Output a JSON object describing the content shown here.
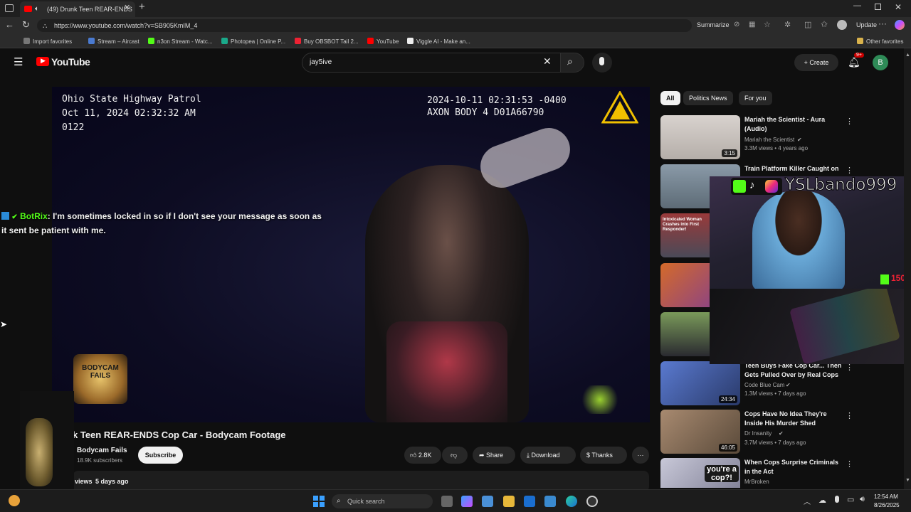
{
  "browser": {
    "tab_title": "(49) Drunk Teen REAR-ENDS",
    "url": "https://www.youtube.com/watch?v=SB905KmIM_4",
    "summarize_label": "Summarize",
    "update_label": "Update",
    "bookmarks": [
      "Import favorites",
      "Stream – Aircast",
      "n3on Stream - Watc...",
      "Photopea | Online P...",
      "Buy OBSBOT Tail 2...",
      "YouTube",
      "Viggle AI - Make an..."
    ],
    "other_favorites": "Other favorites"
  },
  "youtube": {
    "logo": "YouTube",
    "search_value": "jay5ive",
    "create_label": "Create",
    "notif_badge": "9+",
    "avatar_letter": "B"
  },
  "video": {
    "overlay_agency": "Ohio State Highway Patrol",
    "overlay_date": "Oct 11, 2024 02:32:32 AM",
    "overlay_unit": "0122",
    "overlay_timestamp": "2024-10-11 02:31:53 -0400",
    "overlay_device": "AXON BODY 4 D01A66790",
    "watermark_line1": "BODYCAM",
    "watermark_line2": "FAILS",
    "title": "k Teen REAR-ENDS Cop Car - Bodycam Footage",
    "channel": "Bodycam Fails",
    "subscribers": "18.9K subscribers",
    "subscribe_label": "Subscribe",
    "likes": "2.8K",
    "share_label": "Share",
    "download_label": "Download",
    "thanks_label": "Thanks",
    "views": "views",
    "posted": "5 days ago"
  },
  "chips": [
    "All",
    "Politics News",
    "For you"
  ],
  "recommendations": [
    {
      "title": "Mariah the Scientist - Aura (Audio)",
      "channel": "Mariah the Scientist",
      "stats": "3.3M views • 4 years ago",
      "duration": "3:15",
      "thumb": "#c9c3bf"
    },
    {
      "title": "Train Platform Killer Caught on",
      "channel": "",
      "stats": "",
      "duration": "",
      "thumb": "#7b8b98"
    },
    {
      "title": "",
      "channel": "",
      "stats": "",
      "duration": "",
      "thumb": "#8a3b3b",
      "thumb_text": "Intoxicated Woman Crashes into First Responder!"
    },
    {
      "title": "",
      "channel": "",
      "stats": "",
      "duration": "",
      "thumb": "#b04a2a"
    },
    {
      "title": "",
      "channel": "",
      "stats": "",
      "duration": "",
      "thumb": "#5b7d4c"
    },
    {
      "title": "Teen Buys Fake Cop Car... Then Gets Pulled Over by Real Cops",
      "channel": "Code Blue Cam",
      "stats": "1.3M views • 7 days ago",
      "duration": "24:34",
      "thumb": "#3c5ca8"
    },
    {
      "title": "Cops Have No Idea They're Inside His Murder Shed",
      "channel": "Dr Insanity",
      "stats": "3.7M views • 7 days ago",
      "duration": "46:05",
      "thumb": "#8b6e5a"
    },
    {
      "title": "When Cops Surprise Criminals in the Act",
      "channel": "MrBroken",
      "stats": "",
      "duration": "",
      "thumb": "#9aa0b0",
      "thumb_text": "you're a cop?!"
    }
  ],
  "stream": {
    "chat_user": "BotRix",
    "chat_message": ": I'm sometimes locked in so if I don't see your message as soon as it sent be patient with me.",
    "handle": "YSLbando999",
    "kick_count": "150"
  },
  "taskbar": {
    "search_placeholder": "Quick search",
    "time": "12:54 AM",
    "date": "8/26/2025"
  }
}
